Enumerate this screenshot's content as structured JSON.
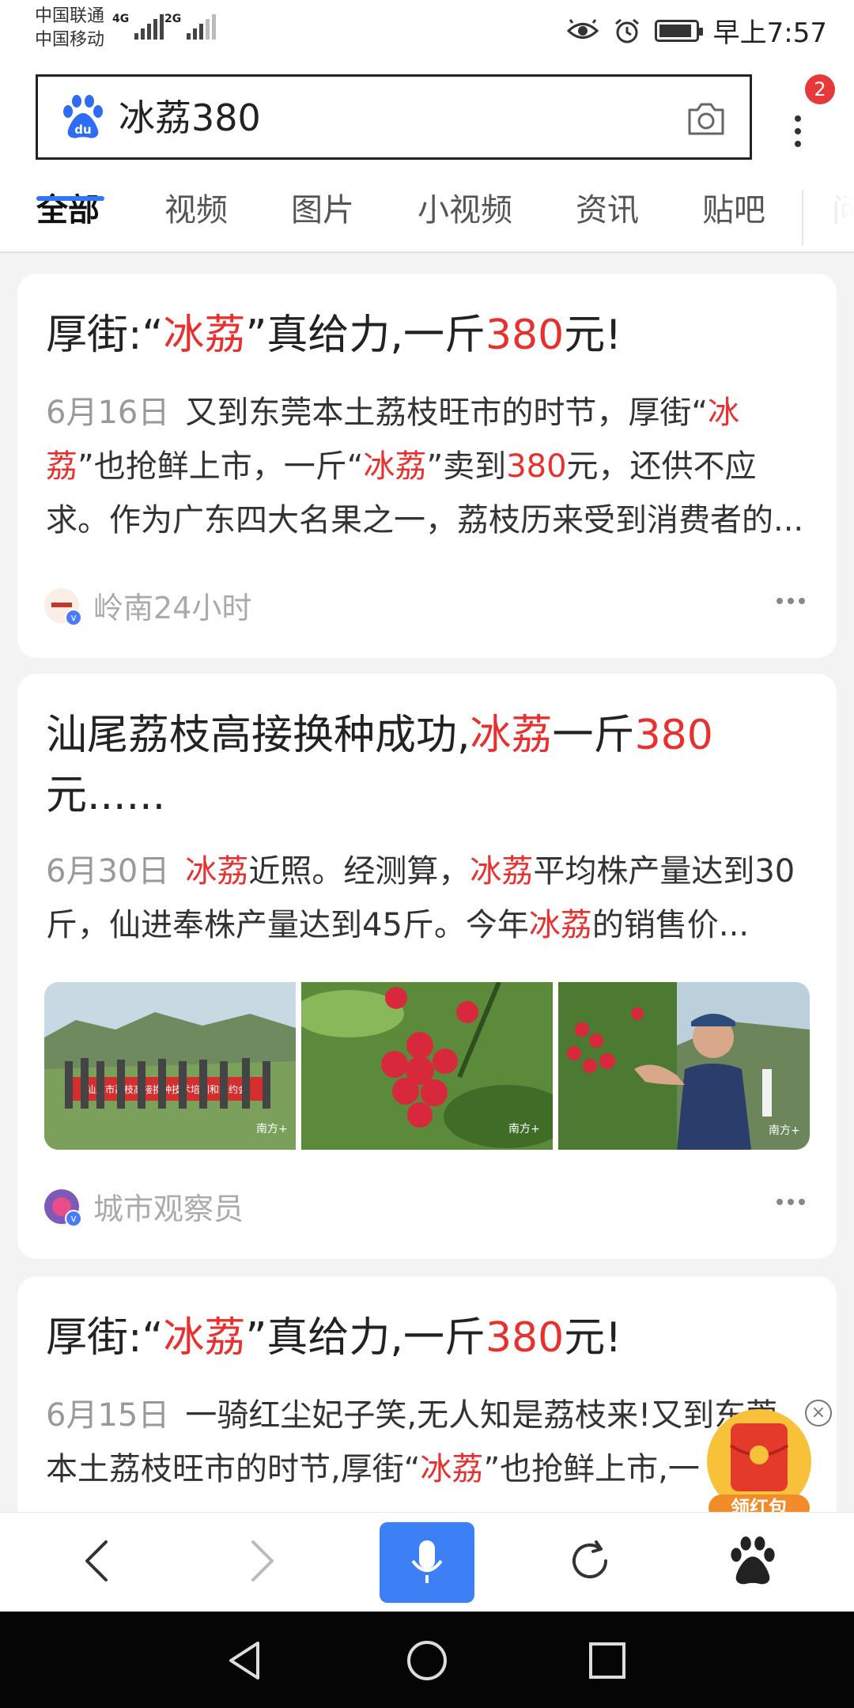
{
  "status_bar": {
    "carrier_1": "中国联通",
    "carrier_2": "中国移动",
    "net_1": "4G",
    "net_2": "2G",
    "time": "早上7:57",
    "battery_level": 0.9
  },
  "search": {
    "query": "冰荔380",
    "logo_icon": "baidu-paw-icon",
    "camera_icon": "camera-icon",
    "more_icon": "more-vertical-icon",
    "notification_count": "2"
  },
  "tabs": [
    {
      "label": "全部",
      "active": true
    },
    {
      "label": "视频",
      "active": false
    },
    {
      "label": "图片",
      "active": false
    },
    {
      "label": "小视频",
      "active": false
    },
    {
      "label": "资讯",
      "active": false
    },
    {
      "label": "贴吧",
      "active": false
    },
    {
      "label": "问",
      "active": false
    }
  ],
  "results": [
    {
      "title": {
        "p1": "厚街:“",
        "h1": "冰荔",
        "p2": "”真给力,一斤",
        "h2": "380",
        "p3": "元!"
      },
      "date": "6月16日",
      "body": {
        "t1": "又到东莞本土荔枝旺市的时节，厚街“",
        "h1": "冰荔",
        "t2": "”也抢鲜上市，一斤“",
        "h2": "冰荔",
        "t3": "”卖到",
        "h3": "380",
        "t4": "元，还供不应求。作为广东四大名果之一，荔枝历来受到消费者的..."
      },
      "source": "岭南24小时"
    },
    {
      "title": {
        "p1": "汕尾荔枝高接换种成功,",
        "h1": "冰荔",
        "p2": "一斤",
        "h2": "380",
        "p3": "元......"
      },
      "date": "6月30日",
      "body": {
        "h1": "冰荔",
        "t1": "近照。经测算，",
        "h2": "冰荔",
        "t2": "平均株产量达到30斤，仙进奉株产量达到45斤。今年",
        "h3": "冰荔",
        "t3": "的销售价..."
      },
      "images": [
        {
          "banner": "汕尾市荔枝高接换种技术培训和签约会",
          "watermark": "南方+"
        },
        {
          "watermark": "南方+"
        },
        {
          "watermark": "南方+"
        }
      ],
      "source": "城市观察员"
    },
    {
      "title": {
        "p1": "厚街:“",
        "h1": "冰荔",
        "p2": "”真给力,一斤",
        "h2": "380",
        "p3": "元!"
      },
      "date": "6月15日",
      "body": {
        "t1": "一骑红尘妃子笑,无人知是荔枝来!又到东莞本土荔枝旺市的时节,厚街“",
        "h1": "冰荔",
        "t2": "”也抢鲜上市,一"
      }
    }
  ],
  "floating": {
    "label": "领红包",
    "close": "×"
  },
  "colors": {
    "highlight": "#e8312f",
    "accent": "#3176f6",
    "mic_button": "#3d80f5",
    "badge": "#e8393a"
  }
}
